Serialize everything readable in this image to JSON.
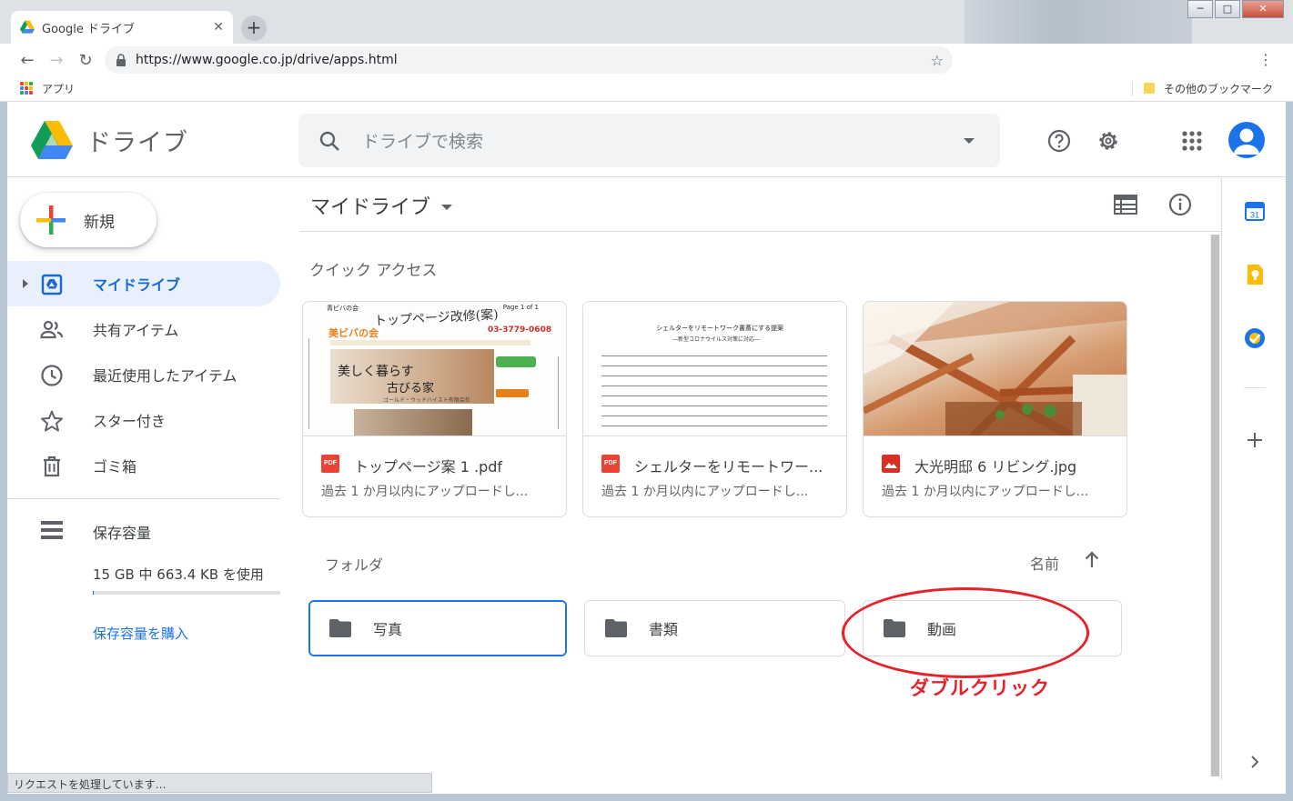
{
  "browser": {
    "tab_title": "Google ドライブ",
    "url": "https://www.google.co.jp/drive/apps.html",
    "bookmark_apps": "アプリ",
    "bookmark_other": "その他のブックマーク",
    "status": "リクエストを処理しています…"
  },
  "header": {
    "app_name": "ドライブ",
    "search_placeholder": "ドライブで検索"
  },
  "sidebar": {
    "new_label": "新規",
    "items": [
      {
        "label": "マイドライブ",
        "icon": "my-drive-icon",
        "active": true
      },
      {
        "label": "共有アイテム",
        "icon": "people-icon"
      },
      {
        "label": "最近使用したアイテム",
        "icon": "clock-icon"
      },
      {
        "label": "スター付き",
        "icon": "star-icon"
      },
      {
        "label": "ゴミ箱",
        "icon": "trash-icon"
      }
    ],
    "storage_label": "保存容量",
    "storage_used": "15 GB 中 663.4 KB を使用",
    "storage_fraction": 0.0001,
    "storage_buy": "保存容量を購入"
  },
  "main": {
    "breadcrumb": "マイドライブ",
    "quick_access_title": "クイック アクセス",
    "quick_access": [
      {
        "name": "トップページ案 1 .pdf",
        "type": "pdf",
        "sub": "過去 1 か月以内にアップロードし..."
      },
      {
        "name": "シェルターをリモートワー...",
        "type": "pdf",
        "sub": "過去 1 か月以内にアップロードし..."
      },
      {
        "name": "大光明邸 6 リビング.jpg",
        "type": "image",
        "sub": "過去 1 か月以内にアップロードし..."
      }
    ],
    "doc1_thumb": {
      "tag": "青ビバの会",
      "page": "Page 1 of 1",
      "handwriting_title": "トップページ改修(案)",
      "phone": "03-3779-0608",
      "tagline_1": "美しく暮らす",
      "tagline_2": "古びる家",
      "bottom": "ゴールド・ウッドハイスト有限会社"
    },
    "doc2_thumb": {
      "title": "シェルターをリモートワーク書斎にする提案",
      "subtitle": "―新型コロナウイルス対策に対応―"
    },
    "folders_title": "フォルダ",
    "sort_label": "名前",
    "folders": [
      {
        "name": "写真",
        "selected": true
      },
      {
        "name": "書類",
        "selected": false
      },
      {
        "name": "動画",
        "selected": false
      }
    ],
    "annotation": "ダブルクリック"
  },
  "side_panel": {
    "calendar_day": "31"
  },
  "colors": {
    "accent": "#1a73e8",
    "annotation_red": "#e8202a",
    "active_nav_bg": "#e8f0fe"
  }
}
